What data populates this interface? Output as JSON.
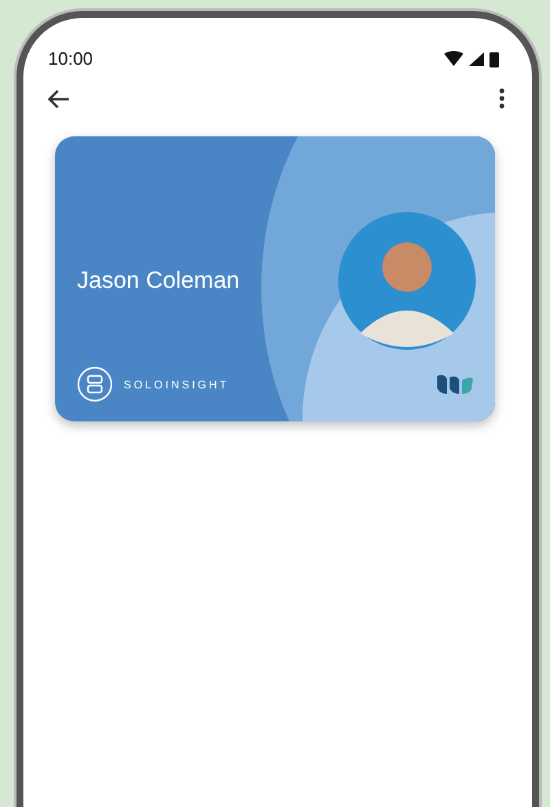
{
  "status_bar": {
    "time": "10:00"
  },
  "card": {
    "name": "Jason Coleman",
    "brand": "SOLOINSIGHT"
  }
}
